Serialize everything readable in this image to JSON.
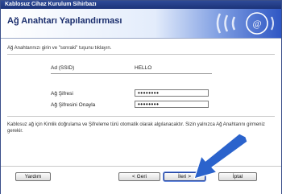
{
  "window": {
    "title": "Kablosuz Cihaz Kurulum Sihirbazı"
  },
  "header": {
    "title": "Ağ Anahtarı Yapılandırması"
  },
  "instruction": "Ağ Anahtarınızı girin ve \"sonraki\" tuşunu tıklayın.",
  "form": {
    "ssid_label": "Ad (SSID)",
    "ssid_value": "HELLO",
    "key_label": "Ağ Şifresi",
    "key_value": "••••••••",
    "confirm_label": "Ağ Şifresini Onayla",
    "confirm_value": "••••••••"
  },
  "note": "Kablosuz ağ için Kimlik doğrulama ve Şifreleme türü otomatik olarak algılanacaktır. Sizin yalnızca Ağ Anahtarını girmeniz gerekir.",
  "buttons": {
    "help": "Yardım",
    "back": "< Geri",
    "next": "İleri >",
    "cancel": "İptal"
  },
  "colors": {
    "title_bar": "#1c3378",
    "header_accent": "#2f57c4",
    "arrow": "#2b63cc"
  },
  "icons": {
    "header_graphic": "wireless-signal-icon",
    "pointer": "arrow-pointer-icon"
  }
}
